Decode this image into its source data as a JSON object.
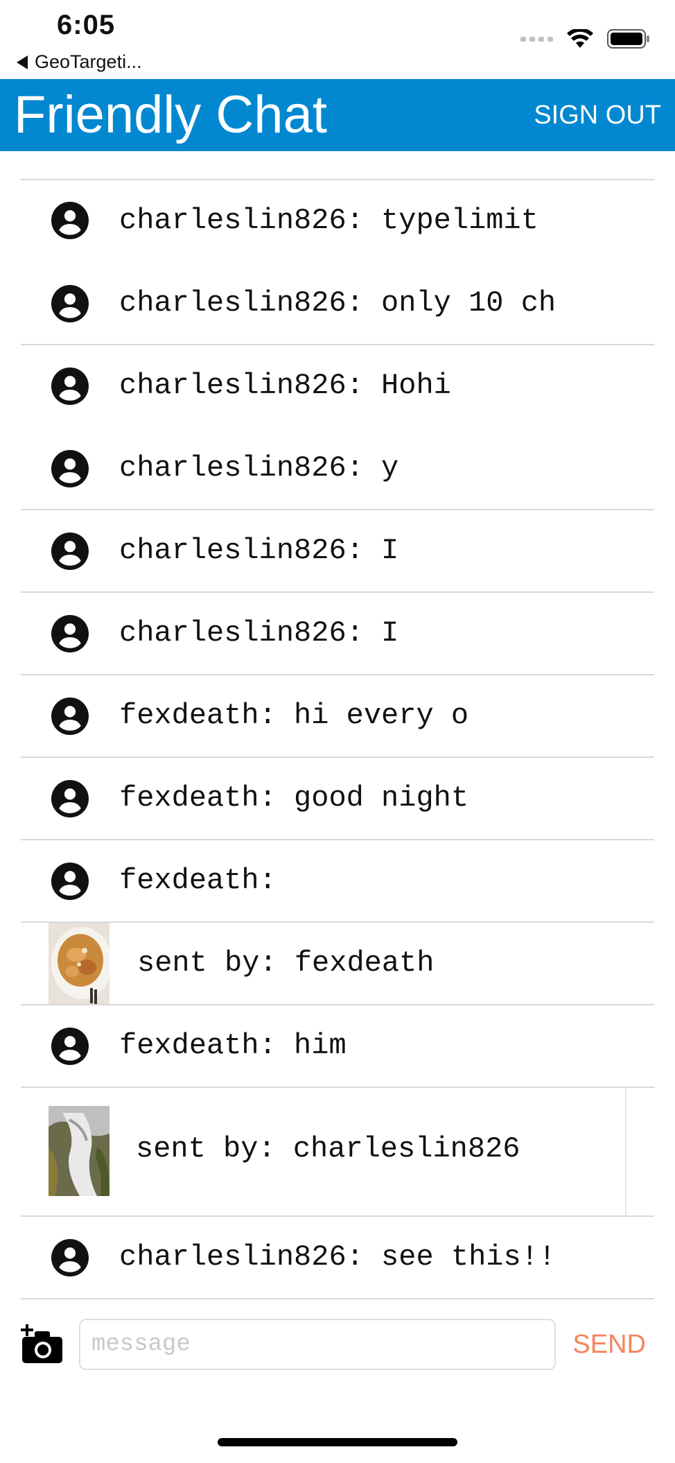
{
  "status_bar": {
    "time": "6:05",
    "back_app": "GeoTargeti..."
  },
  "app_bar": {
    "title": "Friendly Chat",
    "sign_out_label": "SIGN OUT",
    "color": "#0288d1"
  },
  "messages": [
    {
      "type": "text",
      "text": "charleslin826: typelimit"
    },
    {
      "type": "text",
      "text": "charleslin826: only 10 ch"
    },
    {
      "type": "text",
      "text": "charleslin826: Hohi"
    },
    {
      "type": "text",
      "text": "charleslin826: y"
    },
    {
      "type": "text",
      "text": "charleslin826: I"
    },
    {
      "type": "text",
      "text": "charleslin826: I"
    },
    {
      "type": "text",
      "text": "fexdeath: hi every o"
    },
    {
      "type": "text",
      "text": "fexdeath: good night"
    },
    {
      "type": "text",
      "text": "fexdeath:"
    },
    {
      "type": "image",
      "text": "sent by: fexdeath",
      "image_icon": "food-photo"
    },
    {
      "type": "text",
      "text": "fexdeath: him"
    },
    {
      "type": "image",
      "text": "sent by: charleslin826",
      "image_icon": "waterfall-photo"
    },
    {
      "type": "text",
      "text": "charleslin826: see this!!"
    }
  ],
  "composer": {
    "placeholder": "message",
    "send_label": "SEND",
    "send_color": "#f4845f",
    "camera_icon": "add-photo-camera-icon"
  }
}
